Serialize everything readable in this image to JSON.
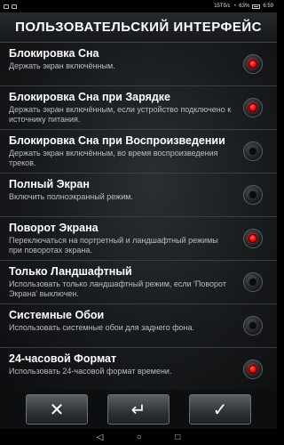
{
  "status_bar": {
    "speed": "15Тб/с",
    "battery_percent": "63%",
    "time": "6:59"
  },
  "header": {
    "title": "ПОЛЬЗОВАТЕЛЬСКИЙ ИНТЕРФЕЙС"
  },
  "settings": [
    {
      "title": "Блокировка Сна",
      "desc": "Держать экран включённым.",
      "enabled": true
    },
    {
      "title": "Блокировка Сна при Зарядке",
      "desc": "Держать экран включённым, если устройство подключено к источнику питания.",
      "enabled": true
    },
    {
      "title": "Блокировка Сна при Воспроизведении",
      "desc": "Держать экран включённым, во время воспроизведения треков.",
      "enabled": false
    },
    {
      "title": "Полный Экран",
      "desc": "Включить полноэкранный режим.",
      "enabled": false
    },
    {
      "title": "Поворот Экрана",
      "desc": "Переключаться на портретный и ландшафтный режимы при поворотах экрана.",
      "enabled": true
    },
    {
      "title": "Только Ландшафтный",
      "desc": "Использовать только ландшафтный режим, если 'Поворот Экрана' выключен.",
      "enabled": false
    },
    {
      "title": "Системные Обои",
      "desc": "Использовать системные обои для заднего фона.",
      "enabled": false
    },
    {
      "title": "24-часовой Формат",
      "desc": "Использовать 24-часовой формат времени.",
      "enabled": true
    }
  ],
  "buttons": {
    "cancel_icon": "close-icon",
    "back_icon": "undo-icon",
    "confirm_icon": "check-icon",
    "cancel_glyph": "✕",
    "back_glyph": "↵",
    "confirm_glyph": "✓"
  },
  "nav_bar": {
    "back_icon": "◁",
    "home_icon": "○",
    "recents_icon": "□"
  },
  "colors": {
    "accent_on": "#e00000",
    "background": "#171a1c"
  }
}
